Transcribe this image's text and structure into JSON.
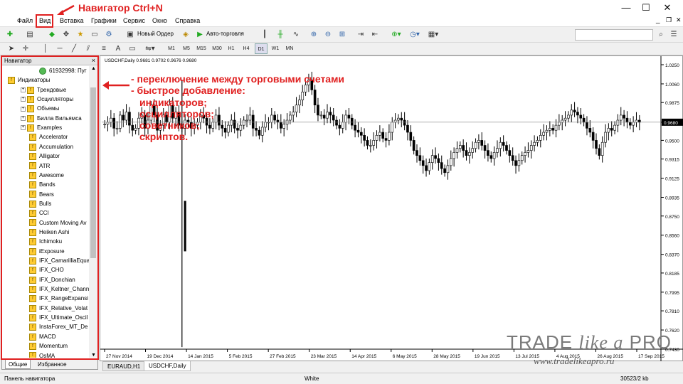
{
  "menu": {
    "items": [
      {
        "label": "Файл"
      },
      {
        "label": "Вид"
      },
      {
        "label": "Вставка"
      },
      {
        "label": "Графики"
      },
      {
        "label": "Сервис"
      },
      {
        "label": "Окно"
      },
      {
        "label": "Справка"
      }
    ]
  },
  "annotations": {
    "title": "Навигатор Ctrl+N",
    "lines": [
      "- переключение между торговыми счетами",
      "- быстрое добавление:"
    ],
    "sublines": [
      "индикаторов;",
      "осцилляторов;",
      "советников;",
      "скриптов."
    ]
  },
  "toolbar": {
    "new_order_label": "Новый Ордер",
    "auto_trading_label": "Авто-торговля",
    "timeframes": [
      "M1",
      "M5",
      "M15",
      "M30",
      "H1",
      "H4",
      "D1",
      "W1",
      "MN"
    ],
    "active_timeframe": "D1"
  },
  "navigator": {
    "title": "Навигатор",
    "close_glyph": "×",
    "account": "61932998: Пуг",
    "indicators_label": "Индикаторы",
    "folders": [
      "Трендовые",
      "Осцилляторы",
      "Объемы",
      "Билла Вильямса",
      "Examples"
    ],
    "items": [
      "Accelerator",
      "Accumulation",
      "Alligator",
      "ATR",
      "Awesome",
      "Bands",
      "Bears",
      "Bulls",
      "CCI",
      "Custom Moving Av",
      "Heiken Ashi",
      "Ichimoku",
      "iExposure",
      "IFX_CamarilliaEqua",
      "IFX_CHO",
      "IFX_Donchian",
      "IFX_Keltner_Chann",
      "IFX_RangeExpansi",
      "IFX_Relative_Volat",
      "IFX_Ultimate_Oscil",
      "InstaForex_MT_De",
      "MACD",
      "Momentum",
      "OsMA"
    ],
    "tabs": [
      "Общие",
      "Избранное"
    ]
  },
  "chart": {
    "title": "USDCHF,Daily  0.9681 0.9702 0.9676 0.9680",
    "current_price": "0.9680",
    "tabs": [
      "EURAUD,H1",
      "USDCHF,Daily"
    ],
    "active_tab": "USDCHF,Daily",
    "colors": {
      "bull_wick_accent": "#22aa22",
      "price_line": "#808080",
      "price_tag": "#000000"
    }
  },
  "chart_data": {
    "type": "candlestick",
    "symbol": "USDCHF",
    "timeframe": "Daily",
    "x_tick_labels": [
      "27 Nov 2014",
      "19 Dec 2014",
      "14 Jan 2015",
      "5 Feb 2015",
      "27 Feb 2015",
      "23 Mar 2015",
      "14 Apr 2015",
      "6 May 2015",
      "28 May 2015",
      "19 Jun 2015",
      "13 Jul 2015",
      "4 Aug 2015",
      "26 Aug 2015",
      "17 Sep 2015"
    ],
    "y_tick_labels": [
      "1.0250",
      "1.0060",
      "0.9875",
      "0.9680",
      "0.9500",
      "0.9315",
      "0.9125",
      "0.8935",
      "0.8750",
      "0.8560",
      "0.8370",
      "0.8185",
      "0.7995",
      "0.7810",
      "0.7620",
      "0.7430"
    ],
    "ylim": [
      0.743,
      1.025
    ],
    "close_series": [
      0.966,
      0.968,
      0.972,
      0.962,
      0.962,
      0.975,
      0.97,
      0.978,
      0.965,
      0.96,
      0.962,
      0.972,
      0.975,
      0.962,
      0.97,
      0.985,
      0.975,
      0.96,
      0.965,
      0.975,
      0.968,
      0.985,
      0.972,
      0.978,
      0.965,
      0.962,
      0.97,
      0.968,
      0.962,
      0.965,
      0.968,
      0.975,
      0.972,
      0.965,
      0.962,
      0.968,
      0.975,
      0.965,
      0.962,
      0.958,
      0.965,
      0.97,
      0.962,
      0.96,
      0.965,
      0.97,
      0.97,
      0.975,
      0.962,
      0.96,
      0.955,
      0.963,
      0.968,
      0.968,
      0.975,
      0.97,
      0.968,
      0.962,
      0.966,
      0.97,
      0.975,
      0.978,
      0.985,
      0.99,
      0.998,
      1.005,
      1.01,
      1.0,
      0.985,
      0.975,
      0.975,
      0.972,
      0.978,
      0.975,
      0.97,
      0.965,
      0.962,
      0.968,
      0.975,
      0.972,
      0.965,
      0.96,
      0.958,
      0.955,
      0.95,
      0.945,
      0.945,
      0.95,
      0.955,
      0.958,
      0.952,
      0.95,
      0.958,
      0.968,
      0.97,
      0.972,
      0.97,
      0.965,
      0.958,
      0.95,
      0.94,
      0.935,
      0.93,
      0.925,
      0.92,
      0.928,
      0.935,
      0.932,
      0.928,
      0.922,
      0.918,
      0.925,
      0.932,
      0.938,
      0.942,
      0.945,
      0.94,
      0.935,
      0.938,
      0.942,
      0.948,
      0.95,
      0.945,
      0.94,
      0.935,
      0.932,
      0.938,
      0.942,
      0.948,
      0.945,
      0.94,
      0.935,
      0.93,
      0.925,
      0.93,
      0.935,
      0.938,
      0.94,
      0.945,
      0.948,
      0.95,
      0.955,
      0.958,
      0.96,
      0.962,
      0.96,
      0.965,
      0.968,
      0.97,
      0.972,
      0.975,
      0.98,
      0.978,
      0.975,
      0.972,
      0.968,
      0.962,
      0.958,
      0.95,
      0.942,
      0.935,
      0.948,
      0.958,
      0.962,
      0.96,
      0.965,
      0.97,
      0.975,
      0.972,
      0.968,
      0.965,
      0.968,
      0.97,
      0.968
    ],
    "annotated_prices": {
      "last": 0.968,
      "jan15_low": 0.84,
      "mar_high": 1.01,
      "aug_high": 0.99
    }
  },
  "status": {
    "left": "Панель навигатора",
    "profile": "White",
    "traffic": "30523/2 kb"
  },
  "watermark": {
    "logo_a": "TRADE",
    "logo_b": "like a",
    "logo_c": "PRO",
    "url": "www.tradelikeapro.ru"
  }
}
